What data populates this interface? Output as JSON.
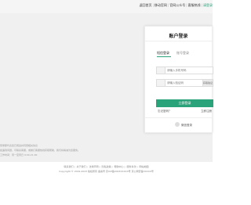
{
  "topnav": {
    "items": [
      "返回首页",
      "移动官网",
      "官网公众号",
      "客服热线"
    ],
    "last_visible": "请登录"
  },
  "login": {
    "title": "账户登录",
    "tabs": [
      "短信登录",
      "账号登录"
    ],
    "phone_placeholder": "请输入手机号码",
    "code_placeholder": "请输入验证码",
    "send_code": "获取验证码",
    "submit": "立即登录",
    "forgot": "忘记密码？",
    "register": "立即注册",
    "wechat": "微信登录"
  },
  "notes": {
    "line1": "登录即代表您已阅读并同意相关协议",
    "line2": "如遇到问题，可联系客服，或拨打客服热线获取帮助，我们将竭诚为您服务。",
    "line3": "工作时间：周一至周日 9:00-21:00"
  },
  "footer": {
    "links": [
      "联系我们",
      "关于我们",
      "法律声明",
      "隐私政策",
      "帮助中心",
      "服务条款",
      "网站地图"
    ],
    "copyright": "Copyright © 2019-2023 版权所有 备案号 京ICP备2023XXXXX号 京公网安备XXXXX号"
  }
}
